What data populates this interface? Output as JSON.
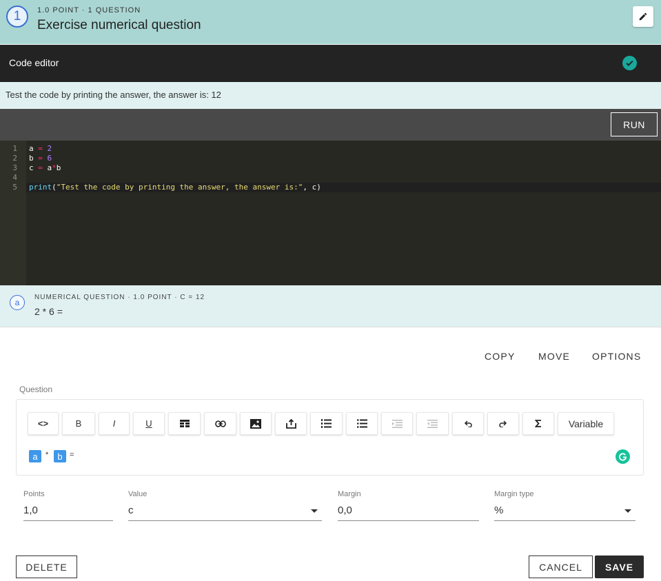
{
  "header": {
    "number": "1",
    "meta": "1.0 POINT · 1 QUESTION",
    "title": "Exercise numerical question",
    "edit_icon": "pencil-icon"
  },
  "code_editor": {
    "label": "Code editor",
    "status_icon": "check-circle-icon",
    "status_color": "#19a89b"
  },
  "hint": "Test the code by printing the answer, the answer is: 12",
  "run_label": "RUN",
  "editor": {
    "line_numbers": [
      "1",
      "2",
      "3",
      "4",
      "5"
    ],
    "lines": [
      "a = 2",
      "b = 6",
      "c = a*b",
      "",
      "print(\"Test the code by printing the answer, the answer is:\", c)"
    ],
    "code": {
      "l1_var": "a",
      "l1_op": "=",
      "l1_val": "2",
      "l2_var": "b",
      "l2_op": "=",
      "l2_val": "6",
      "l3_var": "c",
      "l3_op": "=",
      "l3_a": "a",
      "l3_mul": "*",
      "l3_b": "b",
      "l5_fn": "print",
      "l5_open": "(",
      "l5_str": "\"Test the code by printing the answer, the answer is:\"",
      "l5_rest": ", c)"
    }
  },
  "subquestion": {
    "letter": "a",
    "meta": "NUMERICAL QUESTION · 1.0 POINT · C = 12",
    "expression": "2 * 6 ="
  },
  "actions": {
    "copy": "COPY",
    "move": "MOVE",
    "options": "OPTIONS"
  },
  "question_label": "Question",
  "toolbar": {
    "code": "<>",
    "bold": "B",
    "italic": "I",
    "underline": "U",
    "variable": "Variable"
  },
  "formula": {
    "var_a": "a",
    "op": "*",
    "var_b": "b",
    "eq": "="
  },
  "accent_color": "#3e97ea",
  "fields": {
    "points_label": "Points",
    "points_value": "1,0",
    "value_label": "Value",
    "value_value": "c",
    "margin_label": "Margin",
    "margin_value": "0,0",
    "margin_type_label": "Margin type",
    "margin_type_value": "%"
  },
  "buttons": {
    "delete": "DELETE",
    "cancel": "CANCEL",
    "save": "SAVE"
  }
}
